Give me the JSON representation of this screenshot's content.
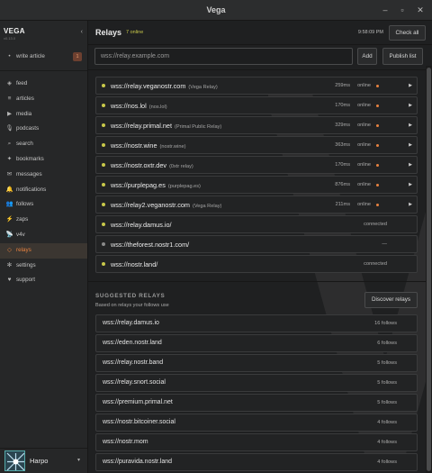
{
  "window": {
    "title": "Vega",
    "minimize": "–",
    "maximize": "▫",
    "close": "✕"
  },
  "sidebar": {
    "brand": "VEGA",
    "version": "v0.13.0",
    "collapse_label": "‹",
    "write": {
      "label": "write article",
      "badge": "1"
    },
    "items": [
      {
        "label": "feed",
        "icon": "feed-icon"
      },
      {
        "label": "articles",
        "icon": "articles-icon"
      },
      {
        "label": "media",
        "icon": "media-icon"
      },
      {
        "label": "podcasts",
        "icon": "podcasts-icon"
      },
      {
        "label": "search",
        "icon": "search-icon"
      },
      {
        "label": "bookmarks",
        "icon": "bookmarks-icon"
      },
      {
        "label": "messages",
        "icon": "messages-icon"
      },
      {
        "label": "notifications",
        "icon": "bell-icon"
      },
      {
        "label": "follows",
        "icon": "people-icon"
      },
      {
        "label": "zaps",
        "icon": "lightning-icon"
      },
      {
        "label": "v4v",
        "icon": "satellite-icon"
      },
      {
        "label": "relays",
        "icon": "relays-icon"
      },
      {
        "label": "settings",
        "icon": "gear-icon"
      },
      {
        "label": "support",
        "icon": "heart-icon"
      }
    ],
    "active": "relays",
    "user": {
      "name": "Harpo",
      "menu": "▾"
    }
  },
  "header": {
    "title": "Relays",
    "online": "7 online",
    "time": "9:58:09 PM",
    "check_all": "Check all"
  },
  "add_relay": {
    "placeholder": "wss://relay.example.com",
    "add": "Add",
    "publish": "Publish list"
  },
  "relays": [
    {
      "url": "wss://relay.veganostr.com",
      "name": "(Vega Relay)",
      "latency": "259ms",
      "status": "online",
      "expandable": true
    },
    {
      "url": "wss://nos.lol",
      "name": "(nos.lol)",
      "latency": "170ms",
      "status": "online",
      "expandable": true
    },
    {
      "url": "wss://relay.primal.net",
      "name": "(Primal Public Relay)",
      "latency": "329ms",
      "status": "online",
      "expandable": true
    },
    {
      "url": "wss://nostr.wine",
      "name": "(nostr.wine)",
      "latency": "363ms",
      "status": "online",
      "expandable": true
    },
    {
      "url": "wss://nostr.oxtr.dev",
      "name": "(0xtr relay)",
      "latency": "170ms",
      "status": "online",
      "expandable": true
    },
    {
      "url": "wss://purplepag.es",
      "name": "(purplepag.es)",
      "latency": "876ms",
      "status": "online",
      "expandable": true
    },
    {
      "url": "wss://relay2.veganostr.com",
      "name": "(Vega Relay)",
      "latency": "211ms",
      "status": "online",
      "expandable": true
    },
    {
      "url": "wss://relay.damus.io/",
      "name": "",
      "latency": "",
      "status": "connected",
      "expandable": false
    },
    {
      "url": "wss://theforest.nostr1.com/",
      "name": "",
      "latency": "",
      "status": "—",
      "expandable": false
    },
    {
      "url": "wss://nostr.land/",
      "name": "",
      "latency": "",
      "status": "connected",
      "expandable": false
    }
  ],
  "suggested": {
    "title": "SUGGESTED RELAYS",
    "subtitle": "Based on relays your follows use",
    "discover": "Discover relays",
    "items": [
      {
        "url": "wss://relay.damus.io",
        "follows": "16 follows"
      },
      {
        "url": "wss://eden.nostr.land",
        "follows": "6 follows"
      },
      {
        "url": "wss://relay.nostr.band",
        "follows": "5 follows"
      },
      {
        "url": "wss://relay.snort.social",
        "follows": "5 follows"
      },
      {
        "url": "wss://premium.primal.net",
        "follows": "5 follows"
      },
      {
        "url": "wss://nostr.bitcoiner.social",
        "follows": "4 follows"
      },
      {
        "url": "wss://nostr.mom",
        "follows": "4 follows"
      },
      {
        "url": "wss://puravida.nostr.land",
        "follows": "4 follows"
      }
    ]
  },
  "colors": {
    "accent": "#e8823f",
    "online": "#c8c84a",
    "bg": "#1f2021"
  }
}
